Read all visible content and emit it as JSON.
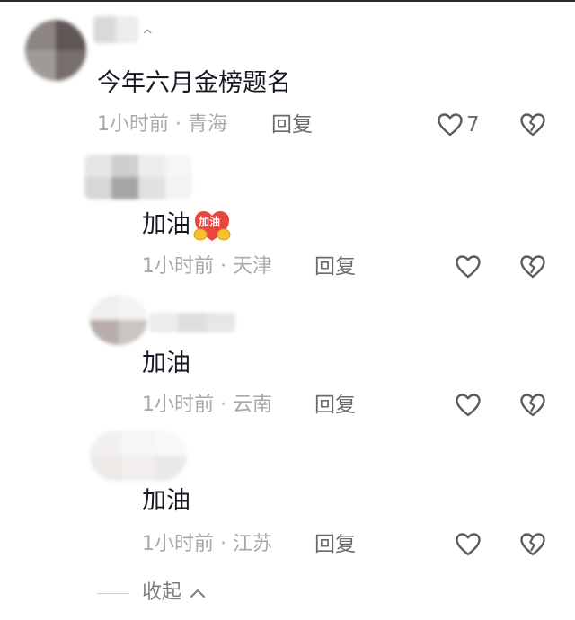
{
  "comments": [
    {
      "username": "^",
      "content": "今年六月金榜题名",
      "time": "1小时前",
      "location": "青海",
      "reply_label": "回复",
      "likes": "7"
    },
    {
      "username": "",
      "content": "加油",
      "emoji_label": "加油",
      "time": "1小时前",
      "location": "天津",
      "reply_label": "回复"
    },
    {
      "username": "",
      "content": "加油",
      "time": "1小时前",
      "location": "云南",
      "reply_label": "回复"
    },
    {
      "username": "",
      "content": "加油",
      "time": "1小时前",
      "location": "江苏",
      "reply_label": "回复"
    }
  ],
  "collapse_label": "收起",
  "colors": {
    "text": "#161823",
    "meta": "#a8a8a8",
    "icon": "#5c5c5c",
    "emoji_red": "#e8473f",
    "emoji_yellow": "#f6c12a"
  },
  "icons": [
    "heart-icon",
    "broken-heart-icon",
    "chevron-up-icon"
  ]
}
